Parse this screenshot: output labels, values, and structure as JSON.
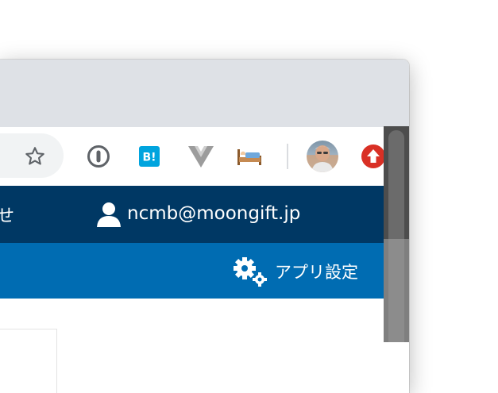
{
  "toolbar": {
    "bookmark_icon": "star-outline-icon",
    "extensions": [
      {
        "name": "password-manager-icon"
      },
      {
        "name": "hatena-bookmark-icon",
        "label": "B!"
      },
      {
        "name": "vue-devtools-icon"
      },
      {
        "name": "bed-icon"
      }
    ],
    "profile": "avatar",
    "update_icon": "update-arrow-icon"
  },
  "header": {
    "left_text": "せ",
    "user_email": "ncmb@moongift.jp"
  },
  "subheader": {
    "app_settings_label": "アプリ設定"
  },
  "colors": {
    "header_bg": "#003864",
    "subheader_bg": "#006cb2",
    "tabstrip_bg": "#dee1e6",
    "update_red": "#d93025"
  }
}
